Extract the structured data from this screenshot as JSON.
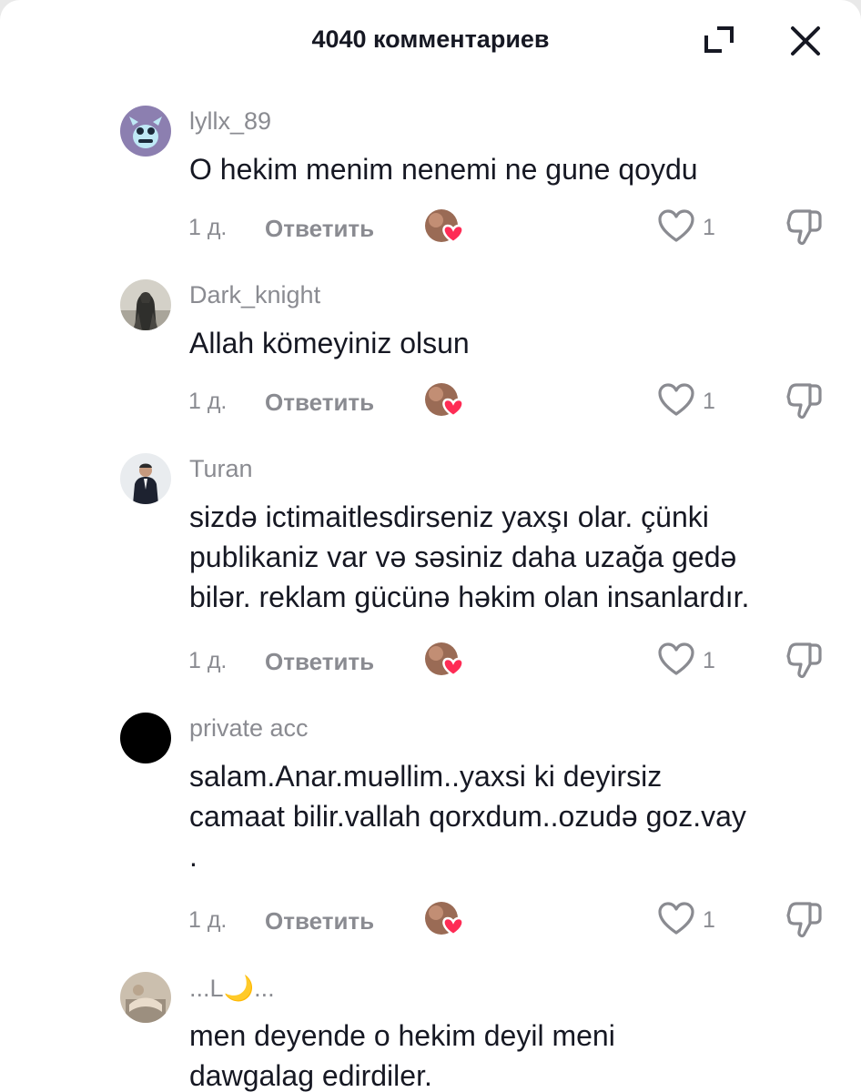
{
  "header": {
    "title": "4040 комментариев",
    "expand_icon": "expand-icon",
    "close_icon": "close-icon"
  },
  "colors": {
    "text_primary": "#161823",
    "text_secondary": "#8a8b91",
    "like_badge": "#fe2c55"
  },
  "comments": [
    {
      "username": "lyllx_89",
      "text": "O hekim menim nenemi ne gune qoydu",
      "time": "1 д.",
      "reply_label": "Ответить",
      "likes": "1"
    },
    {
      "username": "Dark_knight",
      "text": "Allah kömeyiniz olsun",
      "time": "1 д.",
      "reply_label": "Ответить",
      "likes": "1"
    },
    {
      "username": "Turan",
      "text": "sizdə ictimaitlesdirseniz yaxşı olar. çünki\npublikaniz var və səsiniz daha uzağa gedə\nbilər. reklam gücünə həkim olan insanlardır.",
      "time": "1 д.",
      "reply_label": "Ответить",
      "likes": "1"
    },
    {
      "username": "private acc",
      "text": "salam.Anar.muəllim..yaxsi ki deyirsiz\ncamaat bilir.vallah qorxdum..ozudə goz.vay\n.",
      "time": "1 д.",
      "reply_label": "Ответить",
      "likes": "1"
    },
    {
      "username": "...L🌙...",
      "text": "men deyende o hekim deyil meni\ndawgalag edirdiler."
    }
  ]
}
